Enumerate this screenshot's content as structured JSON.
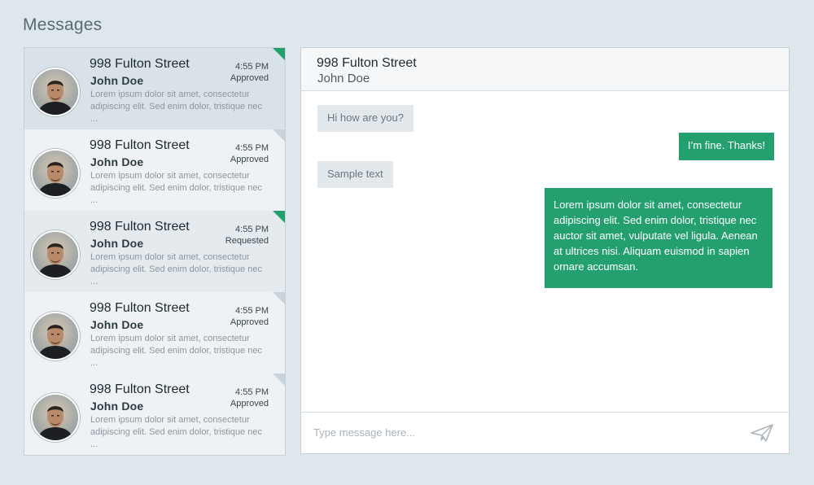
{
  "page": {
    "title": "Messages"
  },
  "conversations": [
    {
      "title": "998 Fulton Street",
      "name": "John Doe",
      "time": "4:55 PM",
      "status": "Approved",
      "preview": "Lorem ipsum dolor sit amet, consectetur adipiscing elit. Sed enim dolor, tristique nec ...",
      "selected": true,
      "flag": "green"
    },
    {
      "title": "998 Fulton Street",
      "name": "John Doe",
      "time": "4:55 PM",
      "status": "Approved",
      "preview": "Lorem ipsum dolor sit amet, consectetur adipiscing elit. Sed enim dolor, tristique nec ...",
      "selected": false,
      "flag": "gray"
    },
    {
      "title": "998 Fulton Street",
      "name": "John Doe",
      "time": "4:55 PM",
      "status": "Requested",
      "preview": "Lorem ipsum dolor sit amet, consectetur adipiscing elit. Sed enim dolor, tristique nec ...",
      "selected": false,
      "flag": "green"
    },
    {
      "title": "998 Fulton Street",
      "name": "John Doe",
      "time": "4:55 PM",
      "status": "Approved",
      "preview": "Lorem ipsum dolor sit amet, consectetur adipiscing elit. Sed enim dolor, tristique nec ...",
      "selected": false,
      "flag": "gray"
    },
    {
      "title": "998 Fulton Street",
      "name": "John Doe",
      "time": "4:55 PM",
      "status": "Approved",
      "preview": "Lorem ipsum dolor sit amet, consectetur adipiscing elit. Sed enim dolor, tristique nec ...",
      "selected": false,
      "flag": "gray"
    }
  ],
  "chat": {
    "title": "998 Fulton Street",
    "subtitle": "John Doe",
    "messages": [
      {
        "direction": "incoming",
        "text": "Hi how are you?"
      },
      {
        "direction": "outgoing",
        "text": "I’m fine. Thanks!"
      },
      {
        "direction": "incoming",
        "text": "Sample text"
      },
      {
        "direction": "outgoing",
        "text": "Lorem ipsum dolor sit amet, consectetur adipiscing elit. Sed enim dolor, tristique nec auctor sit amet, vulputate vel ligula. Aenean at ultrices nisi. Aliquam euismod in sapien ornare accumsan."
      }
    ],
    "composer": {
      "placeholder": "Type message here...",
      "value": "",
      "send_icon": "paper-plane-icon"
    }
  },
  "colors": {
    "accent": "#24a06f",
    "background": "#dde7ec",
    "selected_row": "#d8e2e8",
    "incoming_bubble": "#e2e8ec"
  }
}
